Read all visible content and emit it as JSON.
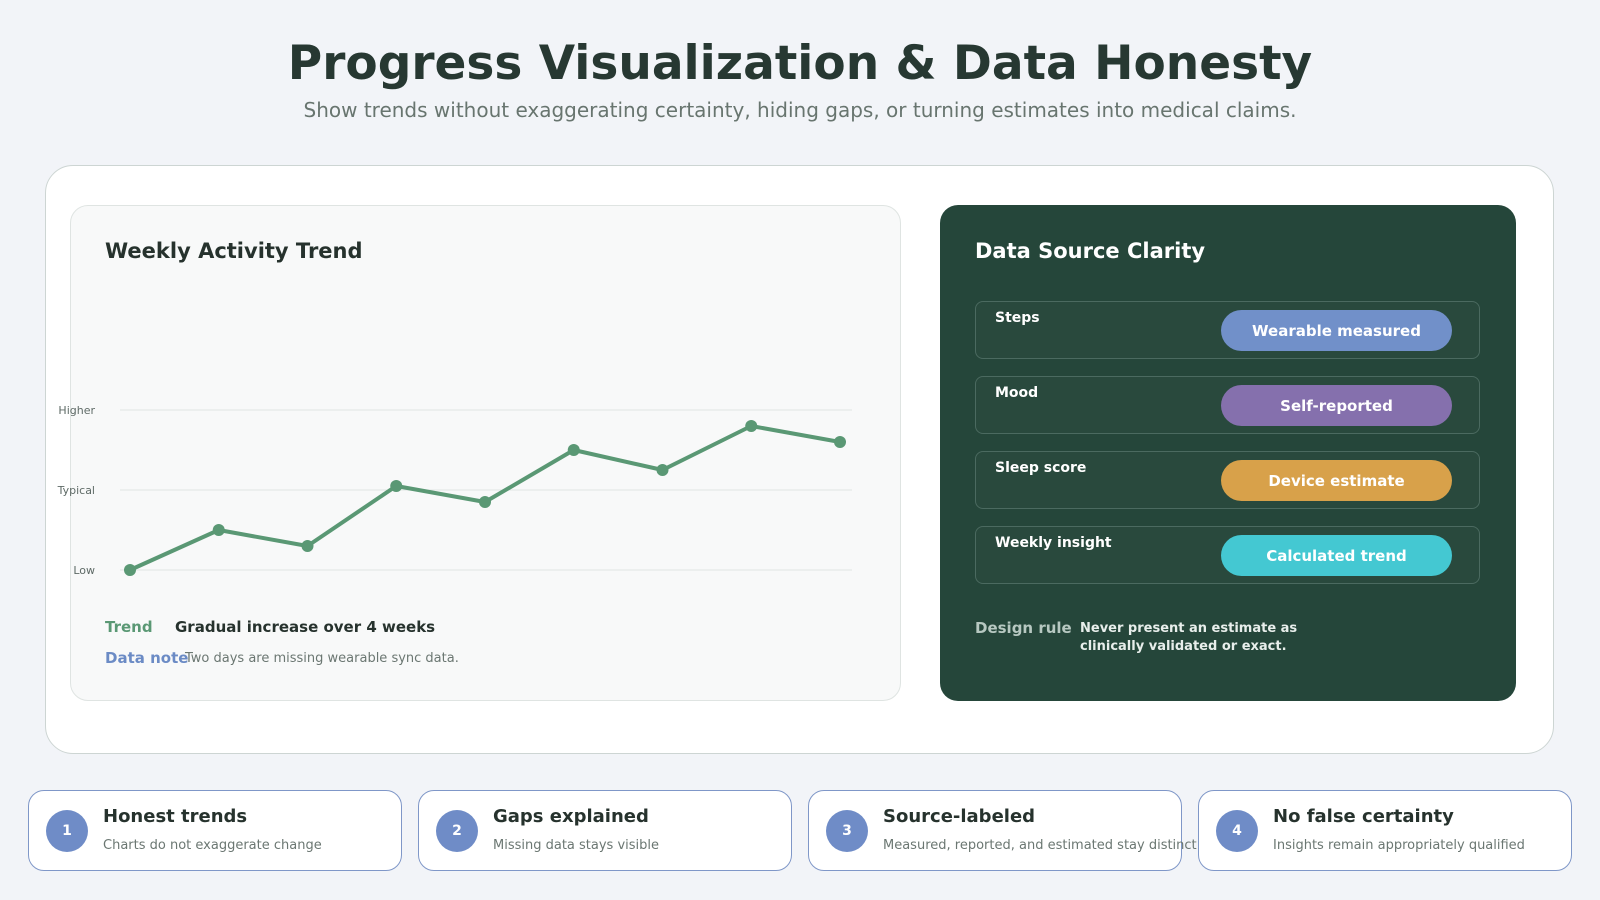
{
  "header": {
    "title": "Progress Visualization & Data Honesty",
    "subtitle": "Show trends without exaggerating certainty, hiding gaps, or turning estimates into medical claims."
  },
  "chart_panel": {
    "title": "Weekly Activity Trend",
    "legend": {
      "trend_key": "Trend",
      "trend_text": "Gradual increase over 4 weeks",
      "note_key": "Data note",
      "note_text": "Two days are missing wearable sync data."
    }
  },
  "chart_data": {
    "type": "line",
    "title": "Weekly Activity Trend",
    "xlabel": "",
    "ylabel": "",
    "y_ticks": [
      "Low",
      "Typical",
      "Higher"
    ],
    "ylim": [
      0,
      2
    ],
    "x": [
      1,
      2,
      3,
      4,
      5,
      6,
      7,
      8,
      9
    ],
    "series": [
      {
        "name": "Trend",
        "color": "#5a9874",
        "values": [
          0.0,
          0.5,
          0.3,
          1.05,
          0.85,
          1.5,
          1.25,
          1.8,
          1.6
        ]
      }
    ],
    "grid": true
  },
  "source_panel": {
    "title": "Data Source Clarity",
    "rows": [
      {
        "label": "Steps",
        "badge": "Wearable measured",
        "color": "#7190c9"
      },
      {
        "label": "Mood",
        "badge": "Self-reported",
        "color": "#8570ad"
      },
      {
        "label": "Sleep score",
        "badge": "Device estimate",
        "color": "#d8a14a"
      },
      {
        "label": "Weekly insight",
        "badge": "Calculated trend",
        "color": "#44c8d2"
      }
    ],
    "design_rule_key": "Design rule",
    "design_rule_text": "Never present an estimate as clinically validated or exact."
  },
  "principles": [
    {
      "number": "1",
      "title": "Honest trends",
      "description": "Charts do not exaggerate change"
    },
    {
      "number": "2",
      "title": "Gaps explained",
      "description": "Missing data stays visible"
    },
    {
      "number": "3",
      "title": "Source-labeled",
      "description": "Measured, reported, and estimated stay distinct"
    },
    {
      "number": "4",
      "title": "No false certainty",
      "description": "Insights remain appropriately qualified"
    }
  ]
}
